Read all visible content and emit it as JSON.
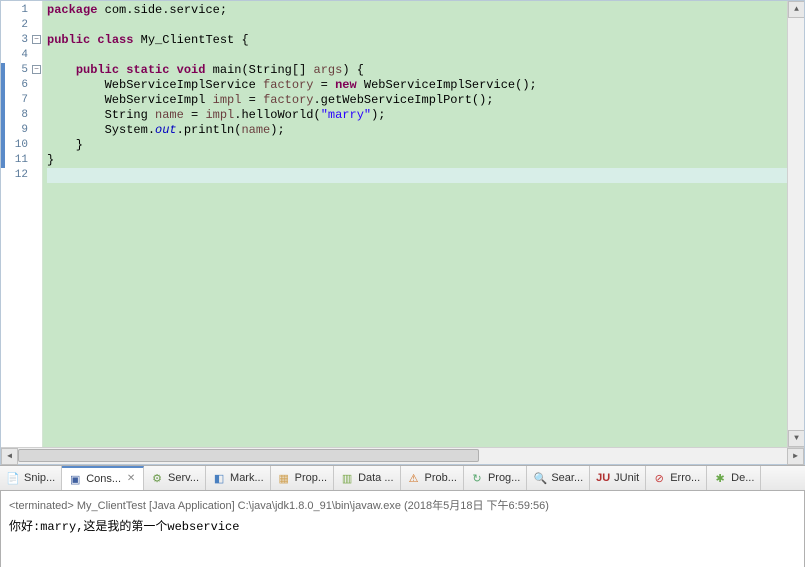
{
  "code": {
    "lines": [
      {
        "n": "1",
        "marker": false,
        "fold": false,
        "tokens": [
          {
            "c": "kw",
            "t": "package"
          },
          {
            "c": "pln",
            "t": " com.side.service;"
          }
        ]
      },
      {
        "n": "2",
        "marker": false,
        "fold": false,
        "tokens": []
      },
      {
        "n": "3",
        "marker": false,
        "fold": true,
        "tokens": [
          {
            "c": "kw",
            "t": "public"
          },
          {
            "c": "pln",
            "t": " "
          },
          {
            "c": "kw",
            "t": "class"
          },
          {
            "c": "pln",
            "t": " My_ClientTest {"
          }
        ]
      },
      {
        "n": "4",
        "marker": false,
        "fold": false,
        "tokens": []
      },
      {
        "n": "5",
        "marker": true,
        "fold": true,
        "tokens": [
          {
            "c": "pln",
            "t": "    "
          },
          {
            "c": "kw",
            "t": "public"
          },
          {
            "c": "pln",
            "t": " "
          },
          {
            "c": "kw",
            "t": "static"
          },
          {
            "c": "pln",
            "t": " "
          },
          {
            "c": "kw",
            "t": "void"
          },
          {
            "c": "pln",
            "t": " main(String[] "
          },
          {
            "c": "var",
            "t": "args"
          },
          {
            "c": "pln",
            "t": ") {"
          }
        ]
      },
      {
        "n": "6",
        "marker": true,
        "fold": false,
        "tokens": [
          {
            "c": "pln",
            "t": "        WebServiceImplService "
          },
          {
            "c": "var",
            "t": "factory"
          },
          {
            "c": "pln",
            "t": " = "
          },
          {
            "c": "kw",
            "t": "new"
          },
          {
            "c": "pln",
            "t": " WebServiceImplService();"
          }
        ]
      },
      {
        "n": "7",
        "marker": true,
        "fold": false,
        "tokens": [
          {
            "c": "pln",
            "t": "        WebServiceImpl "
          },
          {
            "c": "var",
            "t": "impl"
          },
          {
            "c": "pln",
            "t": " = "
          },
          {
            "c": "var",
            "t": "factory"
          },
          {
            "c": "pln",
            "t": ".getWebServiceImplPort();"
          }
        ]
      },
      {
        "n": "8",
        "marker": true,
        "fold": false,
        "tokens": [
          {
            "c": "pln",
            "t": "        String "
          },
          {
            "c": "var",
            "t": "name"
          },
          {
            "c": "pln",
            "t": " = "
          },
          {
            "c": "var",
            "t": "impl"
          },
          {
            "c": "pln",
            "t": ".helloWorld("
          },
          {
            "c": "str",
            "t": "\"marry\""
          },
          {
            "c": "pln",
            "t": ");"
          }
        ]
      },
      {
        "n": "9",
        "marker": true,
        "fold": false,
        "tokens": [
          {
            "c": "pln",
            "t": "        System."
          },
          {
            "c": "fld",
            "t": "out"
          },
          {
            "c": "pln",
            "t": ".println("
          },
          {
            "c": "var",
            "t": "name"
          },
          {
            "c": "pln",
            "t": ");"
          }
        ]
      },
      {
        "n": "10",
        "marker": true,
        "fold": false,
        "tokens": [
          {
            "c": "pln",
            "t": "    }"
          }
        ]
      },
      {
        "n": "11",
        "marker": true,
        "fold": false,
        "tokens": [
          {
            "c": "pln",
            "t": "}"
          }
        ]
      },
      {
        "n": "12",
        "marker": false,
        "fold": false,
        "current": true,
        "tokens": []
      }
    ]
  },
  "tabs": [
    {
      "id": "snip",
      "icon": "📄",
      "iconClass": "icon-snip",
      "label": "Snip..."
    },
    {
      "id": "cons",
      "icon": "▣",
      "iconClass": "icon-cons",
      "label": "Cons...",
      "active": true,
      "closable": true
    },
    {
      "id": "serv",
      "icon": "⚙",
      "iconClass": "icon-serv",
      "label": "Serv..."
    },
    {
      "id": "mark",
      "icon": "◧",
      "iconClass": "icon-mark",
      "label": "Mark..."
    },
    {
      "id": "prop",
      "icon": "▦",
      "iconClass": "icon-prop",
      "label": "Prop..."
    },
    {
      "id": "data",
      "icon": "▥",
      "iconClass": "icon-data",
      "label": "Data ..."
    },
    {
      "id": "prob",
      "icon": "⚠",
      "iconClass": "icon-prob",
      "label": "Prob..."
    },
    {
      "id": "prog",
      "icon": "↻",
      "iconClass": "icon-prog",
      "label": "Prog..."
    },
    {
      "id": "sear",
      "icon": "🔍",
      "iconClass": "icon-sear",
      "label": "Sear..."
    },
    {
      "id": "junit",
      "icon": "JU",
      "iconClass": "icon-junit",
      "label": "JUnit"
    },
    {
      "id": "erro",
      "icon": "⊘",
      "iconClass": "icon-erro",
      "label": "Erro..."
    },
    {
      "id": "de",
      "icon": "✱",
      "iconClass": "icon-de",
      "label": "De..."
    }
  ],
  "console": {
    "header_prefix": "<terminated> ",
    "header_main": "My_ClientTest [Java Application] C:\\java\\jdk1.8.0_91\\bin\\javaw.exe (2018年5月18日 下午6:59:56)",
    "output": "你好:marry,这是我的第一个webservice"
  },
  "fold_glyph": "−",
  "close_glyph": "✕",
  "scroll": {
    "left": "◀",
    "right": "▶",
    "up": "▲",
    "down": "▼"
  }
}
